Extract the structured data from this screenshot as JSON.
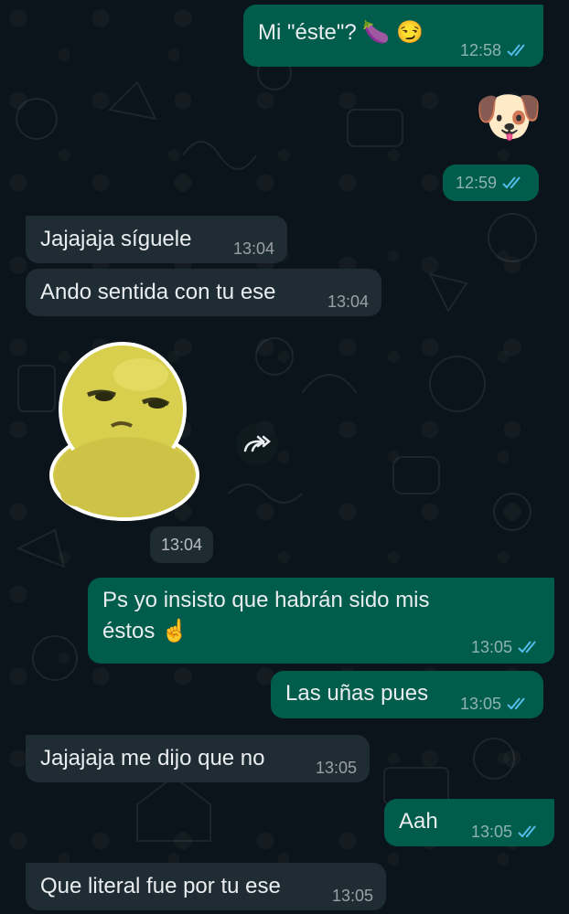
{
  "messages": [
    {
      "id": "m1",
      "dir": "out",
      "text": "Mi \"éste\"? 🍆 😏",
      "time": "12:58",
      "status": "read"
    },
    {
      "id": "m2",
      "dir": "out",
      "type": "emoji-sticker",
      "emoji": "🐶",
      "time": "12:59",
      "status": "read"
    },
    {
      "id": "m3",
      "dir": "in",
      "text": "Jajajaja síguele",
      "time": "13:04"
    },
    {
      "id": "m4",
      "dir": "in",
      "text": "Ando sentida con tu ese",
      "time": "13:04"
    },
    {
      "id": "m5",
      "dir": "in",
      "type": "sticker",
      "sticker": "yellow-character-sticker",
      "time": "13:04"
    },
    {
      "id": "m6",
      "dir": "out",
      "text_line1": "Ps yo insisto que habrán sido mis",
      "text_line2": "éstos ☝️",
      "time": "13:05",
      "status": "read"
    },
    {
      "id": "m7",
      "dir": "out",
      "text": "Las uñas pues",
      "time": "13:05",
      "status": "read"
    },
    {
      "id": "m8",
      "dir": "in",
      "text": "Jajajaja me dijo que no",
      "time": "13:05"
    },
    {
      "id": "m9",
      "dir": "out",
      "text": "Aah",
      "time": "13:05",
      "status": "read"
    },
    {
      "id": "m10",
      "dir": "in",
      "text": "Que literal fue por tu ese",
      "time": "13:05"
    }
  ],
  "colors": {
    "background": "#0b141a",
    "outgoing_bubble": "#005c4b",
    "incoming_bubble": "#202c33",
    "read_ticks": "#53bdeb",
    "text": "#e9edef"
  },
  "icons": [
    "double-check-icon",
    "forward-icon"
  ]
}
